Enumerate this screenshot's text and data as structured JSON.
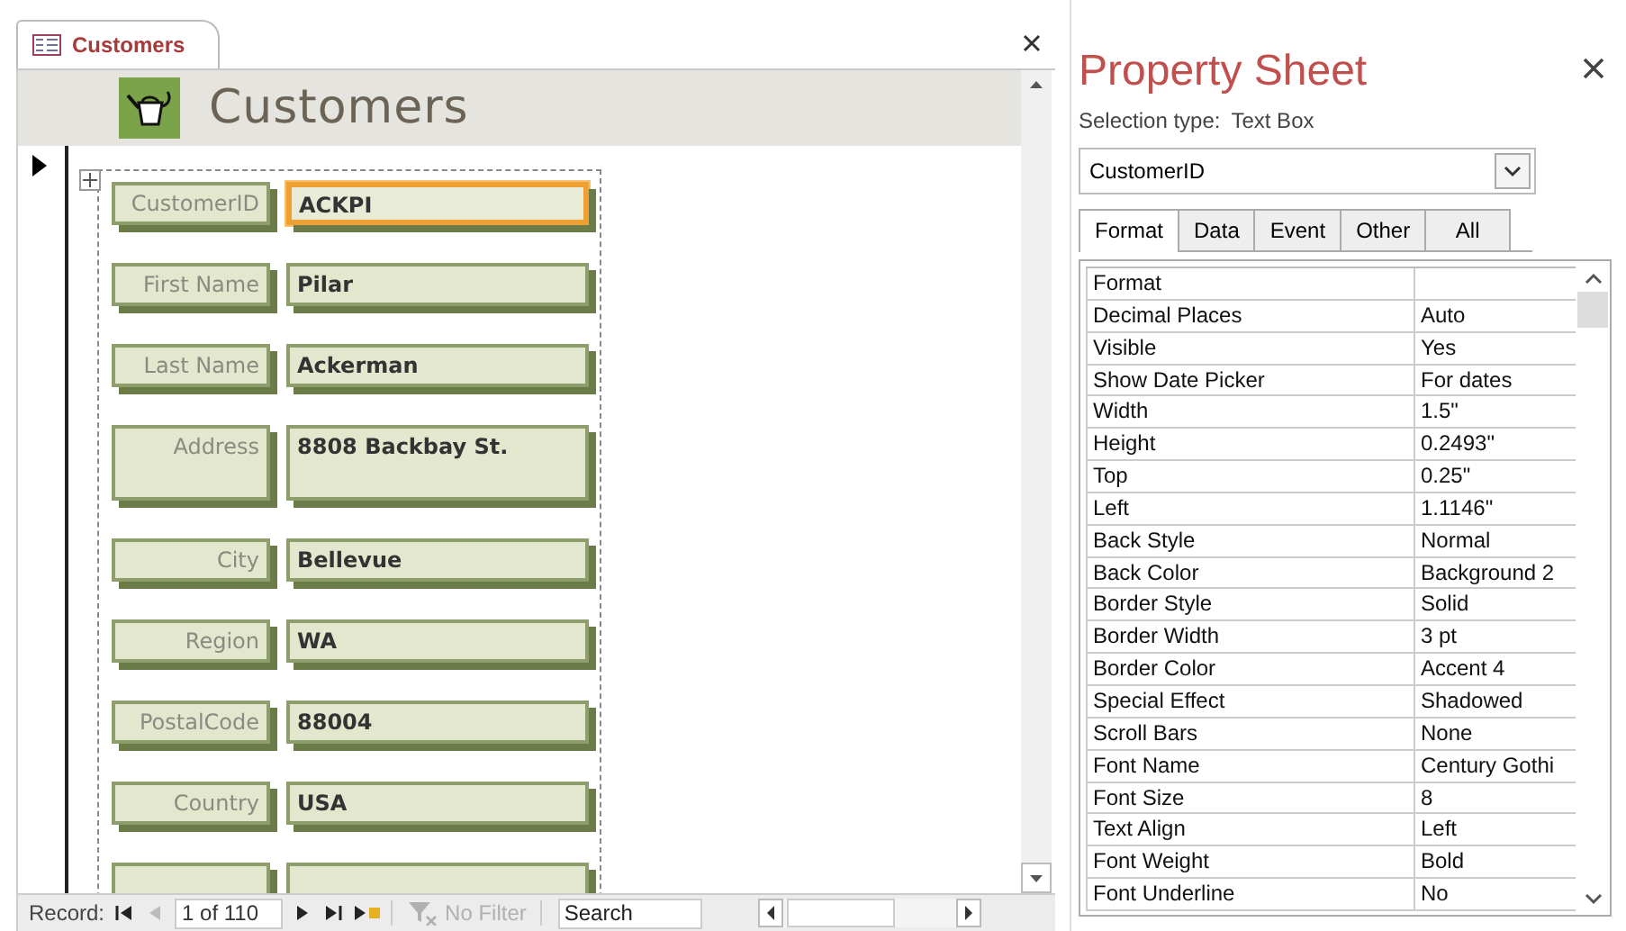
{
  "document_tab": {
    "label": "Customers",
    "selected": true
  },
  "form": {
    "title": "Customers",
    "fields": [
      {
        "label": "CustomerID",
        "value": "ACKPI",
        "kind": "single",
        "selected": true
      },
      {
        "label": "First Name",
        "value": "Pilar",
        "kind": "single",
        "selected": false
      },
      {
        "label": "Last Name",
        "value": "Ackerman",
        "kind": "single",
        "selected": false
      },
      {
        "label": "Address",
        "value": "8808 Backbay St.",
        "kind": "multi",
        "selected": false
      },
      {
        "label": "City",
        "value": "Bellevue",
        "kind": "single",
        "selected": false
      },
      {
        "label": "Region",
        "value": "WA",
        "kind": "single",
        "selected": false
      },
      {
        "label": "PostalCode",
        "value": "88004",
        "kind": "single",
        "selected": false
      },
      {
        "label": "Country",
        "value": "USA",
        "kind": "single",
        "selected": false
      }
    ]
  },
  "navigation": {
    "label": "Record:",
    "position": "1 of 110",
    "filter": "No Filter",
    "filter_disabled": true,
    "search_placeholder": "Search"
  },
  "property_sheet": {
    "title": "Property Sheet",
    "selection_type_label": "Selection type:",
    "selection_type": "Text Box",
    "object": "CustomerID",
    "tabs": [
      {
        "label": "Format",
        "selected": true
      },
      {
        "label": "Data",
        "selected": false
      },
      {
        "label": "Event",
        "selected": false
      },
      {
        "label": "Other",
        "selected": false
      },
      {
        "label": "All",
        "selected": false
      }
    ],
    "properties": [
      {
        "name": "Format"
      },
      {
        "name": "Decimal Places",
        "value": "Auto"
      },
      {
        "name": "Visible",
        "value": "Yes"
      },
      {
        "name": "Show Date Picker",
        "value": "For dates"
      },
      {
        "name": "Width",
        "value": "1.5\""
      },
      {
        "name": "Height",
        "value": "0.2493\""
      },
      {
        "name": "Top",
        "value": "0.25\""
      },
      {
        "name": "Left",
        "value": "1.1146\""
      },
      {
        "name": "Back Style",
        "value": "Normal"
      },
      {
        "name": "Back Color",
        "value": "Background 2"
      },
      {
        "name": "Border Style",
        "value": "Solid"
      },
      {
        "name": "Border Width",
        "value": "3 pt"
      },
      {
        "name": "Border Color",
        "value": "Accent 4"
      },
      {
        "name": "Special Effect",
        "value": "Shadowed"
      },
      {
        "name": "Scroll Bars",
        "value": "None"
      },
      {
        "name": "Font Name",
        "value": "Century Gothi"
      },
      {
        "name": "Font Size",
        "value": "8"
      },
      {
        "name": "Text Align",
        "value": "Left"
      },
      {
        "name": "Font Weight",
        "value": "Bold"
      },
      {
        "name": "Font Underline",
        "value": "No"
      }
    ]
  }
}
